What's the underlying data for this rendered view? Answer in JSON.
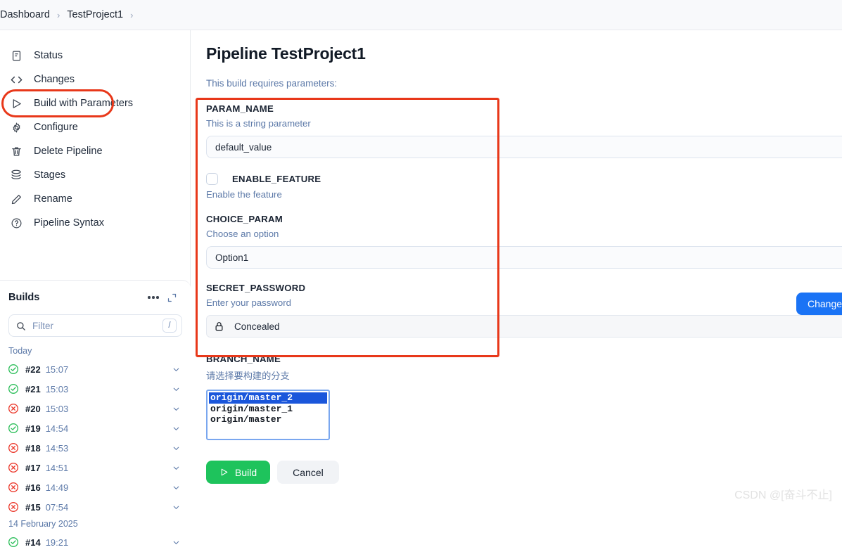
{
  "breadcrumb": {
    "items": [
      {
        "label": "Dashboard"
      },
      {
        "label": "TestProject1"
      }
    ],
    "separator": "›"
  },
  "sidebar": {
    "nav_items": [
      {
        "label": "Status",
        "icon": "document-icon"
      },
      {
        "label": "Changes",
        "icon": "code-brackets-icon"
      },
      {
        "label": "Build with Parameters",
        "icon": "play-triangle-icon"
      },
      {
        "label": "Configure",
        "icon": "gear-icon"
      },
      {
        "label": "Delete Pipeline",
        "icon": "trash-icon"
      },
      {
        "label": "Stages",
        "icon": "stack-layers-icon"
      },
      {
        "label": "Rename",
        "icon": "pencil-icon"
      },
      {
        "label": "Pipeline Syntax",
        "icon": "question-circle-icon"
      }
    ],
    "builds_panel": {
      "title": "Builds",
      "more_icon": "three-dots-icon",
      "expand_icon": "expand-icon",
      "filter": {
        "placeholder": "Filter",
        "value": "",
        "shortcut": "/",
        "icon": "search-icon"
      },
      "groups": [
        {
          "label": "Today",
          "builds": [
            {
              "number": "#22",
              "time": "15:07",
              "status": "success"
            },
            {
              "number": "#21",
              "time": "15:03",
              "status": "success"
            },
            {
              "number": "#20",
              "time": "15:03",
              "status": "failure"
            },
            {
              "number": "#19",
              "time": "14:54",
              "status": "success"
            },
            {
              "number": "#18",
              "time": "14:53",
              "status": "failure"
            },
            {
              "number": "#17",
              "time": "14:51",
              "status": "failure"
            },
            {
              "number": "#16",
              "time": "14:49",
              "status": "failure"
            },
            {
              "number": "#15",
              "time": "07:54",
              "status": "failure"
            }
          ]
        },
        {
          "label": "14 February 2025",
          "builds": [
            {
              "number": "#14",
              "time": "19:21",
              "status": "success"
            }
          ]
        }
      ]
    }
  },
  "main": {
    "page_title": "Pipeline TestProject1",
    "requires_note": "This build requires parameters:",
    "params": [
      {
        "name": "PARAM_NAME",
        "description": "This is a string parameter",
        "type": "string",
        "value": "default_value"
      },
      {
        "name": "ENABLE_FEATURE",
        "description": "Enable the feature",
        "type": "boolean",
        "checked": false
      },
      {
        "name": "CHOICE_PARAM",
        "description": "Choose an option",
        "type": "choice",
        "value": "Option1"
      },
      {
        "name": "SECRET_PASSWORD",
        "description": "Enter your password",
        "type": "password",
        "value": "Concealed",
        "icon": "lock-icon",
        "button_label": "Change Password"
      },
      {
        "name": "BRANCH_NAME",
        "description": "请选择要构建的分支",
        "type": "listbox",
        "options": [
          "origin/master_2",
          "origin/master_1",
          "origin/master"
        ],
        "selected": "origin/master_2"
      }
    ],
    "actions": {
      "build_label": "Build",
      "build_icon": "play-triangle-icon",
      "cancel_label": "Cancel"
    }
  },
  "watermark": "CSDN @[奋斗不止]",
  "colors": {
    "accent_blue": "#1a73f5",
    "success_green": "#1ec35c",
    "failure_red": "#e8381a",
    "annotation_red": "#e8381a",
    "link_blue": "#5c79a8",
    "listbox_selected": "#1a56db"
  }
}
